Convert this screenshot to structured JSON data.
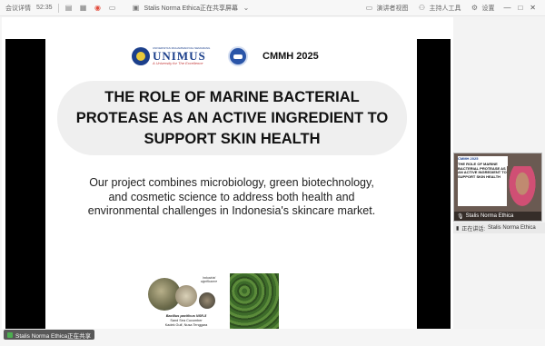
{
  "topbar": {
    "app_label": "会议详情",
    "time": "52:35",
    "sharer": "Stalis Norma Ethica正在共享屏幕",
    "annotate_label": "演讲者视图",
    "host_tools_label": "主持人工具",
    "settings_label": "设置"
  },
  "slide": {
    "unimus_top": "UNIVERSITAS MUHAMMADIYAH SEMARANG",
    "unimus_name": "UNIMUS",
    "unimus_tag": "A University for The Excellence",
    "event": "CMMH 2025",
    "title": "THE ROLE OF MARINE BACTERIAL PROTEASE AS AN ACTIVE INGREDIENT TO SUPPORT SKIN HEALTH",
    "body": "Our project combines microbiology, green biotechnology, and cosmetic science to address both health and environmental challenges in Indonesia's skincare market.",
    "industrial_label": "Industrial significance",
    "caption_species": "Bacillus pacificus NSR-5",
    "caption_line2": "Sand Sea Cucumber",
    "caption_line3": "Kadek Gulf, Nusa Tenggara"
  },
  "participant": {
    "thumb_name": "Stalis Norma Ethica",
    "speaking_label": "正在讲话:",
    "speaking_name": "Stalis Norma Ethica",
    "mini_tag": "CMMH 2025",
    "mini_title": "THE ROLE OF MARINE BACTERIAL PROTEASE AS AN ACTIVE INGREDIENT TO SUPPORT SKIN HEALTH"
  },
  "bottom": {
    "sharing_label": "Stalis Norma Ethica正在共享"
  }
}
